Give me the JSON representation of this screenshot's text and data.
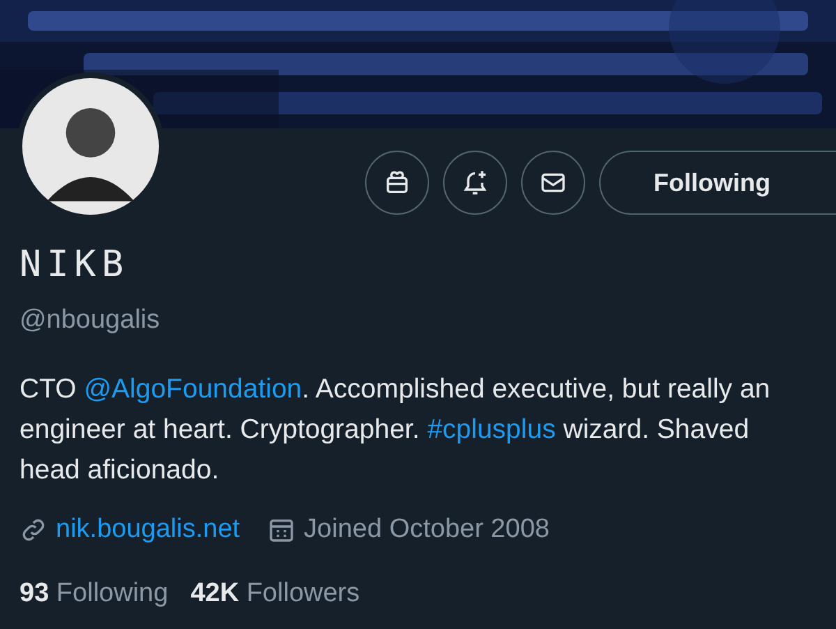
{
  "profile": {
    "name": "NIKB",
    "handle": "@nbougalis",
    "bio": [
      {
        "kind": "text",
        "text": "CTO "
      },
      {
        "kind": "link",
        "text": "@AlgoFoundation"
      },
      {
        "kind": "text",
        "text": ". Accomplished executive, but really an engineer at heart. Cryptographer. "
      },
      {
        "kind": "link",
        "text": "#cplusplus"
      },
      {
        "kind": "text",
        "text": " wizard. Shaved head aficionado."
      }
    ],
    "website": "nik.bougalis.net",
    "joined": "Joined October 2008",
    "stats": [
      {
        "count": "93",
        "label": "Following"
      },
      {
        "count": "42K",
        "label": "Followers"
      }
    ]
  },
  "follow_button": {
    "label": "Following"
  }
}
